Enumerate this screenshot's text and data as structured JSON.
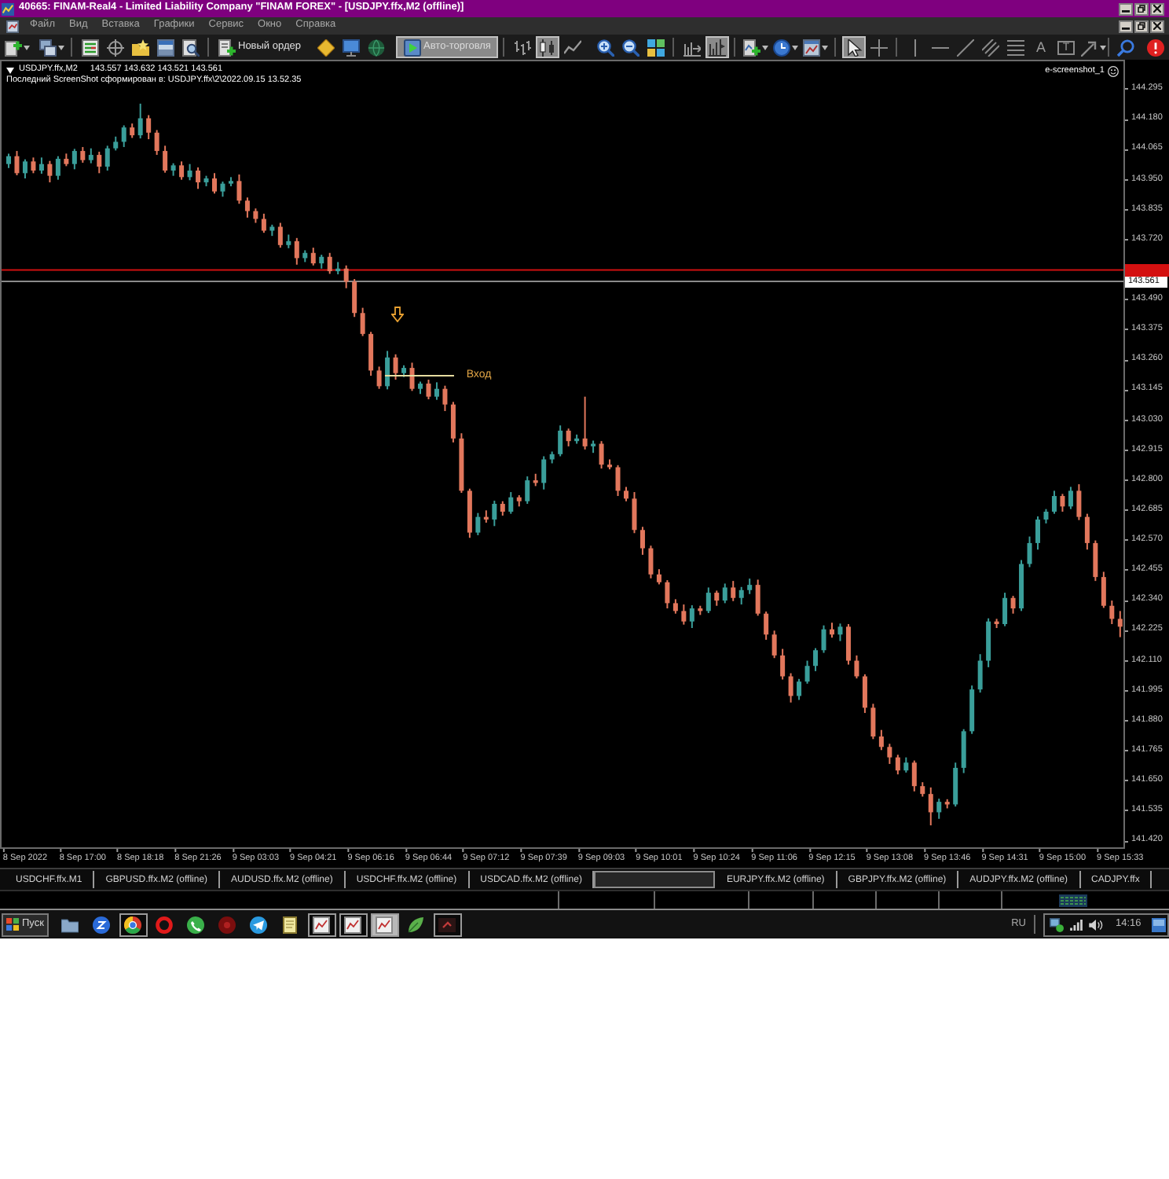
{
  "window": {
    "title": "40665: FINAM-Real4 - Limited Liability Company \"FINAM FOREX\" - [USDJPY.ffx,M2 (offline)]"
  },
  "menu": [
    "Файл",
    "Вид",
    "Вставка",
    "Графики",
    "Сервис",
    "Окно",
    "Справка"
  ],
  "toolbar": [
    [
      {
        "kind": "new-chart",
        "pressed": false
      },
      {
        "kind": "profiles",
        "pressed": false
      }
    ],
    [
      {
        "kind": "market-watch",
        "pressed": false
      },
      {
        "kind": "data-window",
        "pressed": false
      },
      {
        "kind": "navigator",
        "pressed": false
      },
      {
        "kind": "terminal",
        "pressed": false
      },
      {
        "kind": "tester",
        "pressed": false
      }
    ],
    [
      {
        "kind": "new-order",
        "label": "Новый ордер",
        "pressed": false
      },
      {
        "kind": "editor",
        "pressed": false
      },
      {
        "kind": "monitor",
        "pressed": false
      },
      {
        "kind": "globe",
        "pressed": false
      },
      {
        "kind": "auto-trading",
        "label": "Авто-торговля",
        "pressed": true
      }
    ],
    [
      {
        "kind": "bars",
        "pressed": false
      },
      {
        "kind": "candles",
        "pressed": true
      },
      {
        "kind": "line",
        "pressed": false
      },
      {
        "kind": "zoom-in",
        "pressed": false
      },
      {
        "kind": "zoom-out",
        "pressed": false
      },
      {
        "kind": "tile",
        "pressed": false
      }
    ],
    [
      {
        "kind": "autoscroll",
        "pressed": false
      },
      {
        "kind": "chart-shift",
        "pressed": true
      }
    ],
    [
      {
        "kind": "indicators",
        "pressed": false
      },
      {
        "kind": "periods",
        "pressed": false
      },
      {
        "kind": "templates",
        "pressed": false
      }
    ],
    [
      {
        "kind": "cursor",
        "pressed": true
      },
      {
        "kind": "crosshair",
        "pressed": false
      }
    ],
    [
      {
        "kind": "vline",
        "pressed": false
      },
      {
        "kind": "hline",
        "pressed": false
      },
      {
        "kind": "trendline",
        "pressed": false
      },
      {
        "kind": "channel",
        "pressed": false
      },
      {
        "kind": "fibo",
        "pressed": false
      },
      {
        "kind": "text",
        "glyph": "A",
        "pressed": false
      },
      {
        "kind": "label",
        "glyph": "T",
        "pressed": false
      },
      {
        "kind": "arrows",
        "pressed": false
      }
    ],
    [
      {
        "kind": "search",
        "pressed": false
      },
      {
        "kind": "alerts",
        "pressed": false
      }
    ]
  ],
  "chart": {
    "symbol": "USDJPY.ffx,M2",
    "quotes": "143.557 143.632 143.521 143.561",
    "comment": "Последний ScreenShot сформирован в: USDJPY.ffx\\2\\2022.09.15 13.52.35",
    "expert": "e-screenshot_1",
    "chart_data": {
      "type": "candlestick",
      "categories": [
        null,
        null,
        "8 Sep 2022",
        null,
        null,
        null,
        null,
        null,
        null,
        "8 Sep 17:00",
        null,
        null,
        null,
        null,
        null,
        null,
        "8 Sep 18:18",
        null,
        null,
        null,
        null,
        null,
        null,
        "8 Sep 21:26",
        null,
        null,
        null,
        null,
        null,
        null,
        "9 Sep 03:03",
        null,
        null,
        null,
        null,
        null,
        null,
        "9 Sep 04:21",
        null,
        null,
        null,
        null,
        null,
        null,
        "9 Sep 06:16",
        null,
        null,
        null,
        null,
        null,
        null,
        "9 Sep 06:44",
        null,
        null,
        null,
        null,
        null,
        null,
        "9 Sep 07:12",
        null,
        null,
        null,
        null,
        null,
        null,
        "9 Sep 07:39",
        null,
        null,
        null,
        null,
        null,
        null,
        "9 Sep 09:03",
        null,
        null,
        null,
        null,
        null,
        null,
        "9 Sep 10:01",
        null,
        null,
        null,
        null,
        null,
        null,
        "9 Sep 10:24",
        null,
        null,
        null,
        null,
        null,
        null,
        "9 Sep 11:06",
        null,
        null,
        null,
        null,
        null,
        null,
        "9 Sep 12:15",
        null,
        null,
        null,
        null,
        null,
        null,
        "9 Sep 13:08",
        null,
        null,
        null,
        null,
        null,
        null,
        "9 Sep 13:46",
        null,
        null,
        null,
        null,
        null,
        null,
        "9 Sep 14:31",
        null,
        null,
        null,
        null,
        null,
        null,
        "9 Sep 15:00",
        null,
        null,
        null,
        null,
        null,
        null,
        "9 Sep 15:33"
      ],
      "ohlc": [
        [
          144.01,
          144.05,
          143.995,
          144.04
        ],
        [
          144.04,
          144.06,
          143.967,
          143.975
        ],
        [
          143.975,
          144.028,
          143.955,
          144.02
        ],
        [
          144.02,
          144.035,
          143.975,
          143.985
        ],
        [
          143.985,
          144.035,
          143.973,
          144.01
        ],
        [
          144.01,
          144.022,
          143.94,
          143.965
        ],
        [
          143.965,
          144.04,
          143.95,
          144.03
        ],
        [
          144.03,
          144.05,
          144.002,
          144.01
        ],
        [
          144.01,
          144.068,
          143.99,
          144.06
        ],
        [
          144.06,
          144.075,
          144.015,
          144.025
        ],
        [
          144.025,
          144.07,
          144.013,
          144.045
        ],
        [
          144.045,
          144.057,
          143.975,
          144.0
        ],
        [
          144.0,
          144.08,
          143.985,
          144.07
        ],
        [
          144.07,
          144.115,
          144.062,
          144.095
        ],
        [
          144.095,
          144.158,
          144.075,
          144.15
        ],
        [
          144.15,
          144.165,
          144.11,
          144.12
        ],
        [
          144.12,
          144.241,
          144.108,
          144.185
        ],
        [
          144.185,
          144.197,
          144.105,
          144.13
        ],
        [
          144.13,
          144.14,
          144.045,
          144.06
        ],
        [
          144.06,
          144.08,
          143.977,
          143.985
        ],
        [
          143.985,
          144.013,
          143.965,
          144.005
        ],
        [
          144.005,
          144.02,
          143.95,
          143.96
        ],
        [
          143.96,
          144.01,
          143.948,
          143.985
        ],
        [
          143.985,
          143.997,
          143.915,
          143.94
        ],
        [
          143.94,
          143.965,
          143.925,
          143.955
        ],
        [
          143.955,
          143.975,
          143.897,
          143.905
        ],
        [
          143.905,
          143.943,
          143.885,
          143.935
        ],
        [
          143.935,
          143.96,
          143.925,
          143.945
        ],
        [
          143.945,
          143.97,
          143.858,
          143.87
        ],
        [
          143.87,
          143.882,
          143.805,
          143.83
        ],
        [
          143.83,
          143.84,
          143.785,
          143.8
        ],
        [
          143.8,
          143.82,
          143.747,
          143.755
        ],
        [
          143.755,
          143.778,
          143.735,
          143.77
        ],
        [
          143.77,
          143.785,
          143.69,
          143.7
        ],
        [
          143.7,
          143.74,
          143.688,
          143.715
        ],
        [
          143.715,
          143.727,
          143.625,
          143.65
        ],
        [
          143.65,
          143.68,
          143.635,
          143.67
        ],
        [
          143.67,
          143.69,
          143.622,
          143.63
        ],
        [
          143.63,
          143.663,
          143.61,
          143.655
        ],
        [
          143.655,
          143.67,
          143.59,
          143.6
        ],
        [
          143.6,
          143.635,
          143.588,
          143.61
        ],
        [
          143.61,
          143.622,
          143.535,
          143.56
        ],
        [
          143.56,
          143.57,
          143.425,
          143.44
        ],
        [
          143.44,
          143.46,
          143.352,
          143.36
        ],
        [
          143.36,
          143.368,
          143.2,
          143.22
        ],
        [
          143.22,
          143.235,
          143.15,
          143.16
        ],
        [
          143.16,
          143.295,
          143.148,
          143.27
        ],
        [
          143.27,
          143.282,
          143.185,
          143.21
        ],
        [
          143.21,
          143.24,
          143.195,
          143.23
        ],
        [
          143.23,
          143.25,
          143.142,
          143.15
        ],
        [
          143.15,
          143.178,
          143.13,
          143.17
        ],
        [
          143.17,
          143.185,
          143.11,
          143.12
        ],
        [
          143.12,
          143.175,
          143.108,
          143.15
        ],
        [
          143.15,
          143.162,
          143.065,
          143.09
        ],
        [
          143.09,
          143.1,
          142.945,
          142.96
        ],
        [
          142.96,
          142.98,
          142.752,
          142.76
        ],
        [
          142.76,
          142.768,
          142.58,
          142.6
        ],
        [
          142.6,
          142.675,
          142.59,
          142.66
        ],
        [
          142.66,
          142.685,
          142.638,
          142.65
        ],
        [
          142.65,
          142.722,
          142.625,
          142.71
        ],
        [
          142.71,
          142.72,
          142.665,
          142.68
        ],
        [
          142.68,
          142.755,
          142.672,
          142.735
        ],
        [
          142.735,
          142.743,
          142.7,
          142.72
        ],
        [
          142.72,
          142.815,
          142.71,
          142.8
        ],
        [
          142.8,
          142.825,
          142.778,
          142.79
        ],
        [
          142.79,
          142.892,
          142.765,
          142.88
        ],
        [
          142.88,
          142.91,
          142.865,
          142.9
        ],
        [
          142.9,
          143.01,
          142.892,
          142.99
        ],
        [
          142.99,
          142.998,
          142.93,
          142.95
        ],
        [
          142.95,
          142.975,
          142.94,
          142.96
        ],
        [
          142.96,
          143.12,
          142.918,
          142.93
        ],
        [
          142.93,
          142.952,
          142.905,
          142.94
        ],
        [
          142.94,
          142.95,
          142.845,
          142.86
        ],
        [
          142.86,
          142.88,
          142.842,
          142.85
        ],
        [
          142.85,
          142.858,
          142.74,
          142.76
        ],
        [
          142.76,
          142.775,
          142.72,
          142.73
        ],
        [
          142.73,
          142.755,
          142.598,
          142.61
        ],
        [
          142.61,
          142.622,
          142.515,
          142.54
        ],
        [
          142.54,
          142.55,
          142.425,
          142.44
        ],
        [
          142.44,
          142.46,
          142.402,
          142.41
        ],
        [
          142.41,
          142.418,
          142.31,
          142.33
        ],
        [
          142.33,
          142.345,
          142.29,
          142.3
        ],
        [
          142.3,
          142.325,
          142.248,
          142.26
        ],
        [
          142.26,
          142.322,
          142.235,
          142.31
        ],
        [
          142.31,
          142.32,
          142.285,
          142.3
        ],
        [
          142.3,
          142.39,
          142.292,
          142.37
        ],
        [
          142.37,
          142.378,
          142.32,
          142.34
        ],
        [
          142.34,
          142.405,
          142.33,
          142.39
        ],
        [
          142.39,
          142.415,
          142.338,
          142.35
        ],
        [
          142.35,
          142.392,
          142.325,
          142.38
        ],
        [
          142.38,
          142.424,
          142.365,
          142.4
        ],
        [
          142.4,
          142.42,
          142.282,
          142.29
        ],
        [
          142.29,
          142.298,
          142.19,
          142.21
        ],
        [
          142.21,
          142.225,
          142.12,
          142.13
        ],
        [
          142.13,
          142.155,
          142.038,
          142.05
        ],
        [
          142.05,
          142.062,
          141.95,
          141.975
        ],
        [
          141.975,
          142.04,
          141.96,
          142.03
        ],
        [
          142.03,
          142.11,
          142.022,
          142.09
        ],
        [
          142.09,
          142.158,
          142.07,
          142.15
        ],
        [
          142.15,
          142.245,
          142.14,
          142.23
        ],
        [
          142.23,
          142.255,
          142.198,
          142.21
        ],
        [
          142.21,
          142.252,
          142.185,
          142.24
        ],
        [
          142.24,
          142.25,
          142.095,
          142.11
        ],
        [
          142.11,
          142.13,
          142.042,
          142.05
        ],
        [
          142.05,
          142.058,
          141.91,
          141.93
        ],
        [
          141.93,
          141.945,
          141.81,
          141.82
        ],
        [
          141.82,
          141.845,
          141.768,
          141.78
        ],
        [
          141.78,
          141.792,
          141.715,
          141.74
        ],
        [
          141.74,
          141.75,
          141.675,
          141.69
        ],
        [
          141.69,
          141.74,
          141.682,
          141.72
        ],
        [
          141.72,
          141.728,
          141.61,
          141.63
        ],
        [
          141.63,
          141.645,
          141.59,
          141.6
        ],
        [
          141.6,
          141.625,
          141.48,
          141.53
        ],
        [
          141.53,
          141.582,
          141.505,
          141.57
        ],
        [
          141.57,
          141.58,
          141.545,
          141.56
        ],
        [
          141.56,
          141.72,
          141.552,
          141.7
        ],
        [
          141.7,
          141.848,
          141.68,
          141.84
        ],
        [
          141.84,
          142.015,
          141.83,
          142.0
        ],
        [
          142.0,
          142.135,
          141.988,
          142.11
        ],
        [
          142.11,
          142.272,
          142.085,
          142.26
        ],
        [
          142.26,
          142.27,
          142.235,
          142.25
        ],
        [
          142.25,
          142.37,
          142.242,
          142.35
        ],
        [
          142.35,
          142.358,
          142.29,
          142.31
        ],
        [
          142.31,
          142.495,
          142.3,
          142.48
        ],
        [
          142.48,
          142.585,
          142.468,
          142.56
        ],
        [
          142.56,
          142.662,
          142.535,
          142.65
        ],
        [
          142.65,
          142.69,
          142.635,
          142.68
        ],
        [
          142.68,
          142.76,
          142.672,
          142.74
        ],
        [
          142.74,
          142.748,
          142.68,
          142.7
        ],
        [
          142.7,
          142.775,
          142.69,
          142.76
        ],
        [
          142.76,
          142.785,
          142.648,
          142.66
        ],
        [
          142.66,
          142.672,
          142.535,
          142.56
        ],
        [
          142.56,
          142.57,
          142.415,
          142.43
        ],
        [
          142.43,
          142.45,
          142.312,
          142.32
        ],
        [
          142.32,
          142.34,
          142.25,
          142.27
        ],
        [
          142.27,
          142.3,
          142.2,
          142.24
        ]
      ],
      "ylim": [
        141.396,
        144.403
      ],
      "yticks": [
        {
          "value": 144.295,
          "label": "144.295"
        },
        {
          "value": 144.18,
          "label": "144.180"
        },
        {
          "value": 144.065,
          "label": "144.065"
        },
        {
          "value": 143.95,
          "label": "143.950"
        },
        {
          "value": 143.835,
          "label": "143.835"
        },
        {
          "value": 143.72,
          "label": "143.720"
        },
        {
          "value": 143.49,
          "label": "143.490"
        },
        {
          "value": 143.375,
          "label": "143.375"
        },
        {
          "value": 143.26,
          "label": "143.260"
        },
        {
          "value": 143.145,
          "label": "143.145"
        },
        {
          "value": 143.03,
          "label": "143.030"
        },
        {
          "value": 142.915,
          "label": "142.915"
        },
        {
          "value": 142.8,
          "label": "142.800"
        },
        {
          "value": 142.685,
          "label": "142.685"
        },
        {
          "value": 142.57,
          "label": "142.570"
        },
        {
          "value": 142.455,
          "label": "142.455"
        },
        {
          "value": 142.34,
          "label": "142.340"
        },
        {
          "value": 142.225,
          "label": "142.225"
        },
        {
          "value": 142.11,
          "label": "142.110"
        },
        {
          "value": 141.995,
          "label": "141.995"
        },
        {
          "value": 141.88,
          "label": "141.880"
        },
        {
          "value": 141.765,
          "label": "141.765"
        },
        {
          "value": 141.65,
          "label": "141.650"
        },
        {
          "value": 141.535,
          "label": "141.535"
        },
        {
          "value": 141.42,
          "label": "141.420"
        }
      ],
      "ref_lines": [
        {
          "axis": "y",
          "value": 143.605
        },
        {
          "axis": "y",
          "value": 143.561,
          "label": "143.561"
        }
      ],
      "annotations": [
        "Вход"
      ]
    }
  },
  "tabs": [
    {
      "label": "USDCHF.ffx.M1",
      "selected": false
    },
    {
      "label": "GBPUSD.ffx.M2 (offline)",
      "selected": false
    },
    {
      "label": "AUDUSD.ffx.M2 (offline)",
      "selected": false
    },
    {
      "label": "USDCHF.ffx.M2 (offline)",
      "selected": false
    },
    {
      "label": "USDCAD.ffx.M2 (offline)",
      "selected": false
    },
    {
      "selected": true
    },
    {
      "label": "EURJPY.ffx.M2 (offline)",
      "selected": false
    },
    {
      "label": "GBPJPY.ffx.M2 (offline)",
      "selected": false
    },
    {
      "label": "AUDJPY.ffx.M2 (offline)",
      "selected": false
    },
    {
      "label": "CADJPY.ffx",
      "selected": false
    }
  ],
  "taskbar": {
    "start": "Пуск",
    "items": [
      {
        "kind": "folder",
        "window": false,
        "selected": false
      },
      {
        "kind": "circle-app",
        "window": false,
        "selected": false
      },
      {
        "kind": "wheel",
        "window": true,
        "selected": false
      },
      {
        "kind": "ring",
        "window": false,
        "selected": false
      },
      {
        "kind": "phone",
        "window": false,
        "selected": false
      },
      {
        "kind": "disc",
        "window": false,
        "selected": false
      },
      {
        "kind": "plane",
        "window": false,
        "selected": false
      },
      {
        "kind": "notepad",
        "window": false,
        "selected": false
      },
      {
        "kind": "chart-window",
        "window": true,
        "selected": false
      },
      {
        "kind": "chart-window",
        "window": true,
        "selected": false
      },
      {
        "kind": "chart-window",
        "window": true,
        "selected": true
      },
      {
        "kind": "leaf",
        "window": false,
        "selected": false
      },
      {
        "kind": "dark-window",
        "window": true,
        "selected": false
      }
    ],
    "language": "RU",
    "clock": "14:16"
  }
}
